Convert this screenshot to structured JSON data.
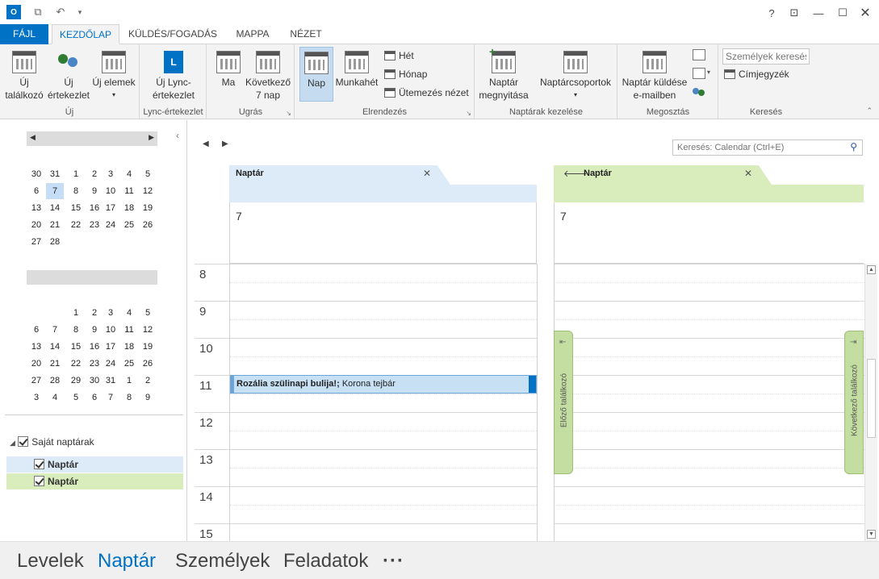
{
  "titlebar": {
    "help": "?"
  },
  "tabs": [
    "FÁJL",
    "KEZDŐLAP",
    "KÜLDÉS/FOGADÁS",
    "MAPPA",
    "NÉZET"
  ],
  "ribbon": {
    "new_meeting": [
      "Új",
      "találkozó"
    ],
    "new_items_prefix": [
      "Új",
      "értekezlet"
    ],
    "new_elements": "Új elemek",
    "group_new": "Új",
    "lync_meeting": [
      "Új Lync-",
      "értekezlet"
    ],
    "group_lync": "Lync-értekezlet",
    "today": "Ma",
    "next7": [
      "Következő",
      "7 nap"
    ],
    "group_goto": "Ugrás",
    "day": "Nap",
    "workweek": "Munkahét",
    "week": "Hét",
    "month": "Hónap",
    "schedule": "Ütemezés nézet",
    "group_arrange": "Elrendezés",
    "open_cal": [
      "Naptár",
      "megnyitása"
    ],
    "cal_groups": "Naptárcsoportok",
    "group_manage": "Naptárak kezelése",
    "send_cal": [
      "Naptár küldése",
      "e-mailben"
    ],
    "group_share": "Megosztás",
    "search_people_placeholder": "Személyek keresése",
    "address_book": "Címjegyzék",
    "group_find": "Keresés"
  },
  "minical1": [
    [
      "30",
      "31",
      "1",
      "2",
      "3",
      "4",
      "5"
    ],
    [
      "6",
      "7",
      "8",
      "9",
      "10",
      "11",
      "12"
    ],
    [
      "13",
      "14",
      "15",
      "16",
      "17",
      "18",
      "19"
    ],
    [
      "20",
      "21",
      "22",
      "23",
      "24",
      "25",
      "26"
    ],
    [
      "27",
      "28",
      "",
      "",
      "",
      "",
      ""
    ]
  ],
  "minical2": [
    [
      "",
      "",
      "1",
      "2",
      "3",
      "4",
      "5"
    ],
    [
      "6",
      "7",
      "8",
      "9",
      "10",
      "11",
      "12"
    ],
    [
      "13",
      "14",
      "15",
      "16",
      "17",
      "18",
      "19"
    ],
    [
      "20",
      "21",
      "22",
      "23",
      "24",
      "25",
      "26"
    ],
    [
      "27",
      "28",
      "29",
      "30",
      "31",
      "1",
      "2"
    ],
    [
      "3",
      "4",
      "5",
      "6",
      "7",
      "8",
      "9"
    ]
  ],
  "folders": {
    "group": "Saját naptárak",
    "items": [
      "Naptár",
      "Naptár"
    ]
  },
  "search_placeholder": "Keresés: Calendar (Ctrl+E)",
  "cal1": {
    "title": "Naptár",
    "day": "7"
  },
  "cal2": {
    "title": "Naptár",
    "day": "7"
  },
  "hours": [
    "8",
    "9",
    "10",
    "11",
    "12",
    "13",
    "14",
    "15"
  ],
  "event": {
    "title": "Rozália szülinapi bulija!;",
    "location": "Korona tejbár"
  },
  "prev_appt": "Előző találkozó",
  "next_appt": "Következő találkozó",
  "nav": [
    "Levelek",
    "Naptár",
    "Személyek",
    "Feladatok",
    "···"
  ],
  "colors": {
    "accent": "#0072c6",
    "cal1": "#dcebf7",
    "cal2": "#d9ecbc",
    "event": "#c7e0f4"
  }
}
